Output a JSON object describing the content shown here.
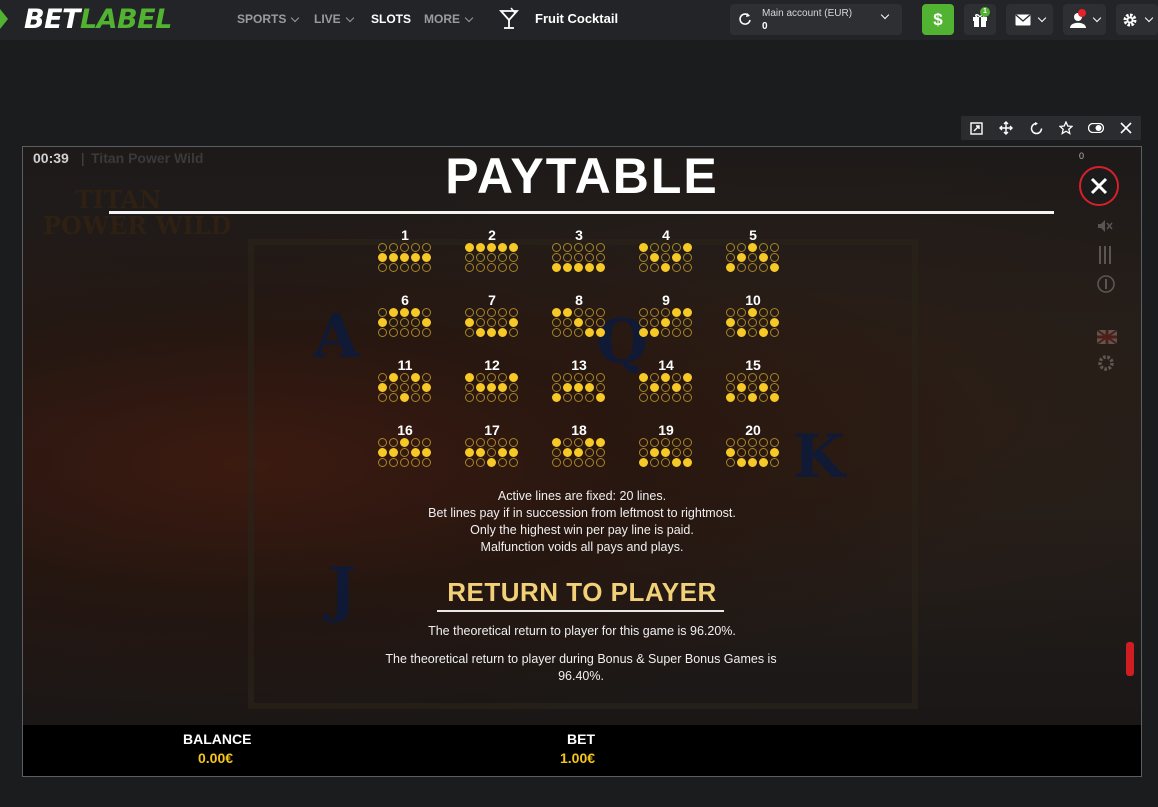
{
  "brand": {
    "part1": "BET",
    "part2": "LABEL"
  },
  "nav": {
    "sports": "SPORTS",
    "live": "LIVE",
    "slots": "SLOTS",
    "more": "MORE",
    "game_name": "Fruit Cocktail"
  },
  "account": {
    "label": "Main account (EUR)",
    "value": "0"
  },
  "deposit": {
    "symbol": "$"
  },
  "gift": {
    "badge": "1"
  },
  "game": {
    "timer": "00:39",
    "title": "Titan Power Wild",
    "logo_line1": "TITAN",
    "logo_line2": "POWER WILD",
    "counter": "0"
  },
  "paytable": {
    "title": "PAYTABLE",
    "lines": [
      {
        "n": "1",
        "rows": [
          "00000",
          "11111",
          "00000"
        ]
      },
      {
        "n": "2",
        "rows": [
          "11111",
          "00000",
          "00000"
        ]
      },
      {
        "n": "3",
        "rows": [
          "00000",
          "00000",
          "11111"
        ]
      },
      {
        "n": "4",
        "rows": [
          "10001",
          "01010",
          "00100"
        ]
      },
      {
        "n": "5",
        "rows": [
          "00100",
          "01010",
          "10001"
        ]
      },
      {
        "n": "6",
        "rows": [
          "01110",
          "10001",
          "00000"
        ]
      },
      {
        "n": "7",
        "rows": [
          "00000",
          "10001",
          "01110"
        ]
      },
      {
        "n": "8",
        "rows": [
          "11000",
          "00100",
          "00011"
        ]
      },
      {
        "n": "9",
        "rows": [
          "00011",
          "00100",
          "11000"
        ]
      },
      {
        "n": "10",
        "rows": [
          "00100",
          "10001",
          "01010"
        ]
      },
      {
        "n": "11",
        "rows": [
          "01010",
          "10001",
          "00100"
        ]
      },
      {
        "n": "12",
        "rows": [
          "10001",
          "01110",
          "00000"
        ]
      },
      {
        "n": "13",
        "rows": [
          "00000",
          "01110",
          "10001"
        ]
      },
      {
        "n": "14",
        "rows": [
          "10101",
          "01010",
          "00000"
        ]
      },
      {
        "n": "15",
        "rows": [
          "00000",
          "01010",
          "10101"
        ]
      },
      {
        "n": "16",
        "rows": [
          "00100",
          "11011",
          "00000"
        ]
      },
      {
        "n": "17",
        "rows": [
          "00000",
          "11011",
          "00100"
        ]
      },
      {
        "n": "18",
        "rows": [
          "10011",
          "01100",
          "00000"
        ]
      },
      {
        "n": "19",
        "rows": [
          "00000",
          "01100",
          "10011"
        ]
      },
      {
        "n": "20",
        "rows": [
          "00000",
          "10001",
          "01110"
        ]
      }
    ],
    "rules": [
      "Active lines are fixed: 20 lines.",
      "Bet lines pay if in succession from leftmost to rightmost.",
      "Only the highest win per pay line is paid.",
      "Malfunction voids all pays and plays."
    ],
    "rtp_title": "RETURN TO PLAYER",
    "rtp_text1": "The theoretical return to player for this game is 96.20%.",
    "rtp_text2": "The theoretical return to player during Bonus & Super Bonus Games is 96.40%."
  },
  "bottom": {
    "balance_label": "BALANCE",
    "balance_value": "0.00€",
    "bet_label": "BET",
    "bet_value": "1.00€"
  },
  "background_letters": [
    "A",
    "Q",
    "K",
    "J"
  ],
  "colors": {
    "brand_green": "#52b231",
    "gold": "#f7c927",
    "close_red": "#d7202a",
    "rtp_gold": "#f1d078"
  },
  "icons": [
    "refresh-icon",
    "gift-icon",
    "mail-icon",
    "user-icon",
    "gear-icon",
    "external-link-icon",
    "move-icon",
    "reload-icon",
    "star-icon",
    "toggle-icon",
    "close-icon",
    "cocktail-icon"
  ]
}
